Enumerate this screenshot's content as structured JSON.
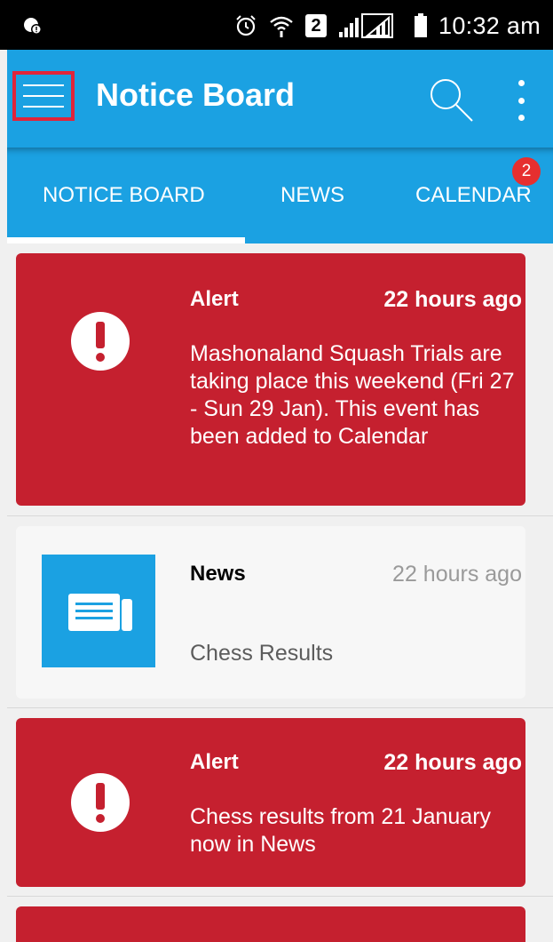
{
  "status_bar": {
    "time": "10:32 am",
    "sim_slot": "2",
    "icons": [
      "notification-icon",
      "alarm-icon",
      "wifi-icon",
      "sim-icon",
      "signal-icon",
      "battery-icon"
    ]
  },
  "app_bar": {
    "title": "Notice Board",
    "color": "#1ba1e2",
    "icons": [
      "menu-icon",
      "search-icon",
      "more-vert-icon"
    ]
  },
  "tabs": {
    "items": [
      {
        "label": "NOTICE BOARD",
        "selected": true
      },
      {
        "label": "NEWS",
        "selected": false
      },
      {
        "label": "CALENDAR",
        "selected": false
      }
    ],
    "calendar_badge": "2"
  },
  "cards": [
    {
      "type": "Alert",
      "time": "22 hours ago",
      "body": "Mashonaland Squash Trials are taking place this weekend (Fri 27 - Sun 29 Jan). This event has been added to Calendar",
      "icon": "alert-icon",
      "color": "#c5202f"
    },
    {
      "type": "News",
      "time": "22 hours ago",
      "body": "Chess Results",
      "icon": "news-icon",
      "color": "#1ba1e2"
    },
    {
      "type": "Alert",
      "time": "22 hours ago",
      "body": "Chess results from 21 January now in News",
      "icon": "alert-icon",
      "color": "#c5202f"
    }
  ]
}
